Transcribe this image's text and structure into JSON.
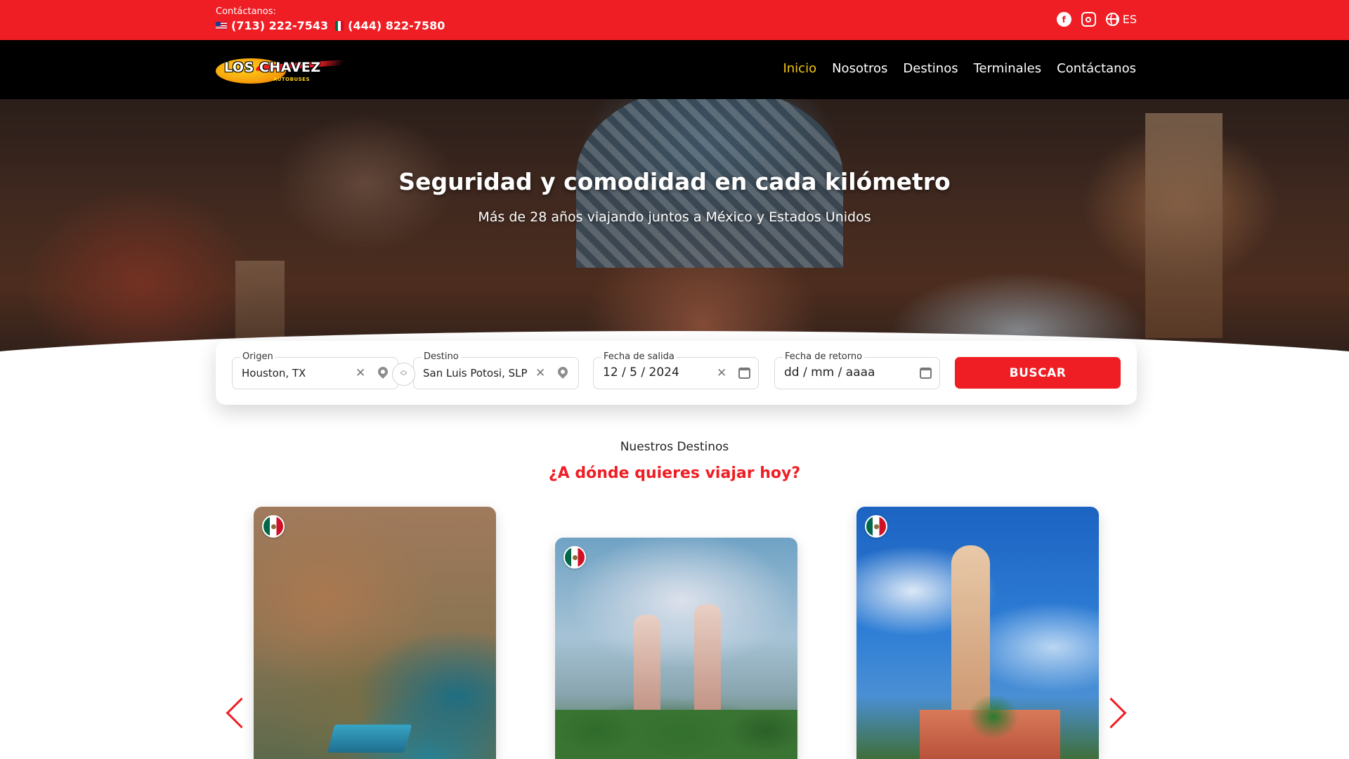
{
  "topbar": {
    "contact_label": "Contáctanos:",
    "phone_us": "(713) 222-7543",
    "phone_mx": "(444) 822-7580",
    "language": "ES",
    "icons": [
      "facebook-icon",
      "instagram-icon",
      "globe-icon"
    ]
  },
  "nav": {
    "logo_text": "LOS CHAVEZ",
    "logo_sub": "AUTOBUSES",
    "links": [
      {
        "label": "Inicio",
        "active": true
      },
      {
        "label": "Nosotros",
        "active": false
      },
      {
        "label": "Destinos",
        "active": false
      },
      {
        "label": "Terminales",
        "active": false
      },
      {
        "label": "Contáctanos",
        "active": false
      }
    ]
  },
  "hero": {
    "title": "Seguridad y comodidad en cada kilómetro",
    "subtitle": "Más de 28 años viajando juntos a México y Estados Unidos"
  },
  "search": {
    "origin_label": "Origen",
    "origin_value": "Houston, TX",
    "destination_label": "Destino",
    "destination_value": "San Luis Potosi, SLP",
    "departure_label": "Fecha de salida",
    "departure_value": "12 / 5 / 2024",
    "return_label": "Fecha de retorno",
    "return_value": "dd / mm / aaaa",
    "button_label": "BUSCAR"
  },
  "destinations": {
    "subtitle": "Nuestros Destinos",
    "title": "¿A dónde quieres viajar hoy?"
  },
  "colors": {
    "brand_red": "#ef1d24",
    "nav_bg": "#000000",
    "active_link": "#f5c518"
  }
}
